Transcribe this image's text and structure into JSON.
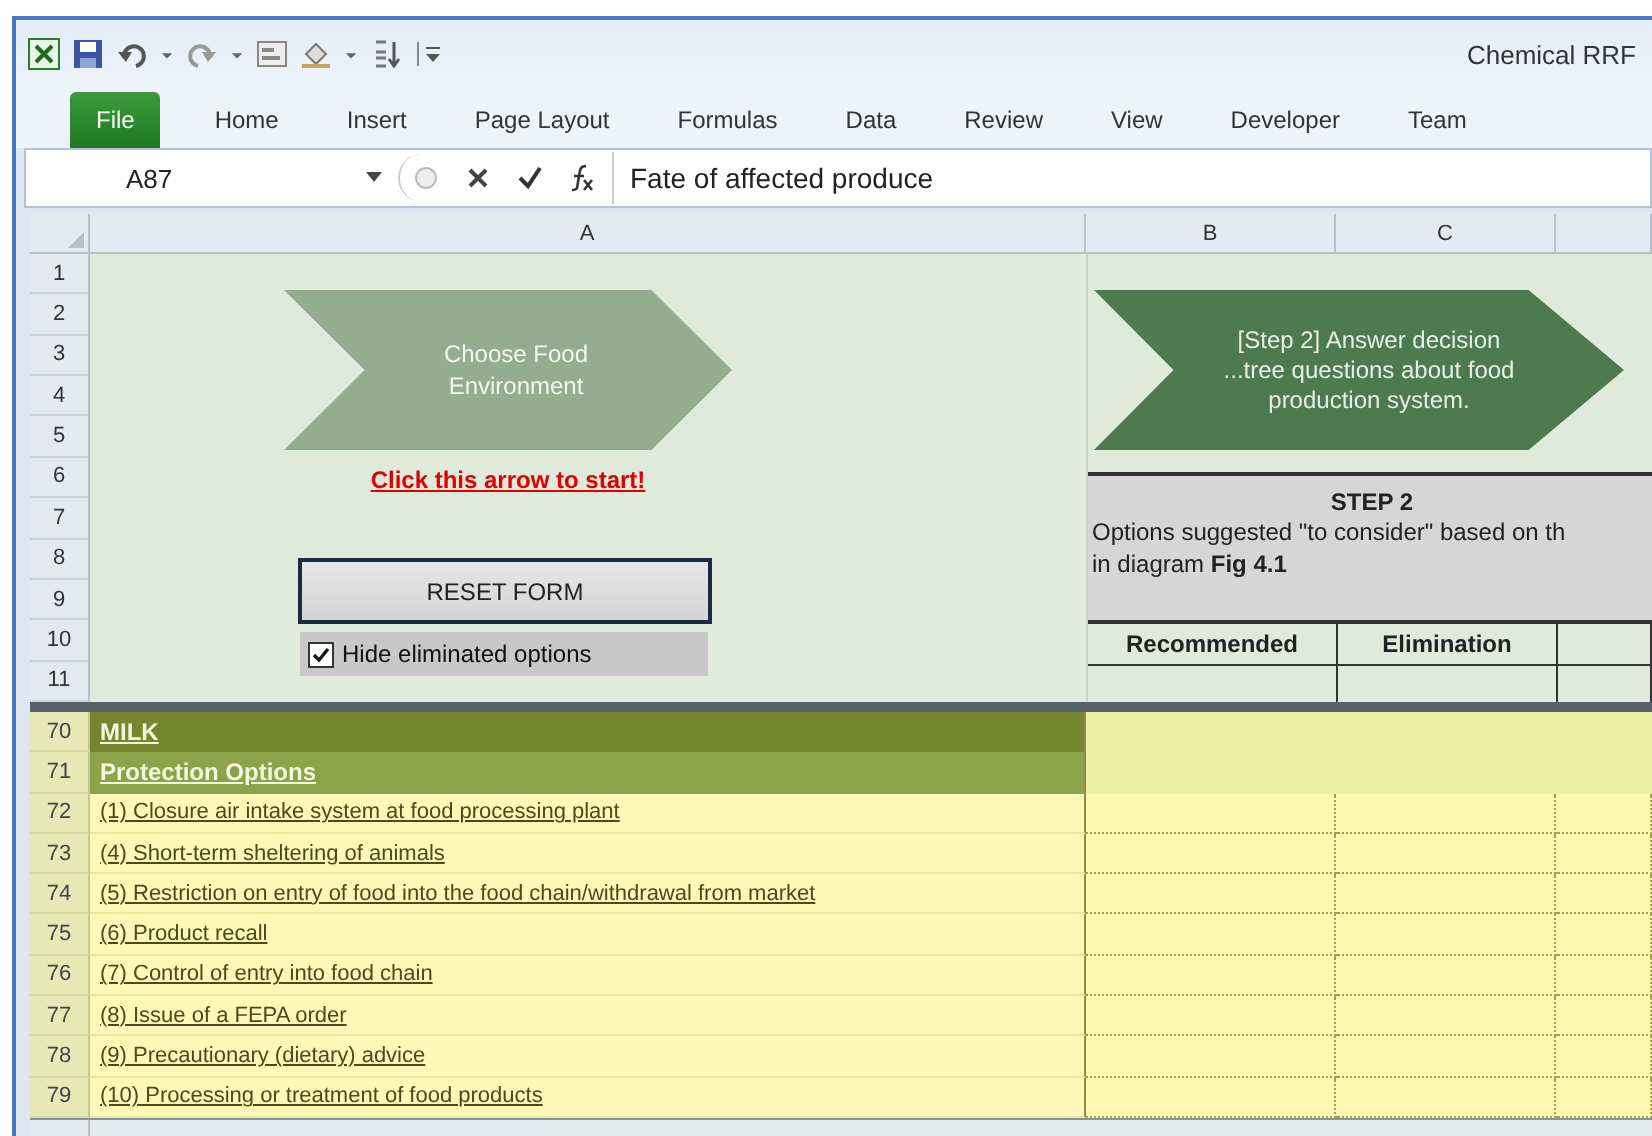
{
  "window": {
    "title": "Chemical RRF"
  },
  "ribbon_tabs": [
    {
      "label": "File",
      "kind": "file"
    },
    {
      "label": "Home",
      "kind": "tab"
    },
    {
      "label": "Insert",
      "kind": "tab"
    },
    {
      "label": "Page Layout",
      "kind": "tab"
    },
    {
      "label": "Formulas",
      "kind": "tab"
    },
    {
      "label": "Data",
      "kind": "tab"
    },
    {
      "label": "Review",
      "kind": "tab"
    },
    {
      "label": "View",
      "kind": "tab"
    },
    {
      "label": "Developer",
      "kind": "tab"
    },
    {
      "label": "Team",
      "kind": "tab"
    }
  ],
  "formula_bar": {
    "name_box": "A87",
    "formula": "Fate of affected produce"
  },
  "columns": [
    "A",
    "B",
    "C"
  ],
  "top_rows": [
    "1",
    "2",
    "3",
    "4",
    "5",
    "6",
    "7",
    "8",
    "9",
    "10",
    "11"
  ],
  "start_arrow": {
    "text": "Choose Food Environment"
  },
  "start_link": "Click this arrow to start!",
  "reset_button": "RESET FORM",
  "hide_option": {
    "label": "Hide eliminated options",
    "checked": true
  },
  "step_arrow": {
    "text": "[Step 2] Answer decision ...tree questions about food production system."
  },
  "step_box": {
    "title": "STEP 2",
    "lines": [
      "Options suggested \"to consider\" based on th",
      "in diagram **Fig 4.1**"
    ]
  },
  "table_headers": [
    "Recommended",
    "Elimination"
  ],
  "rows": [
    {
      "number": "70",
      "kind": "section",
      "text": "MILK"
    },
    {
      "number": "71",
      "kind": "subsection",
      "text": "Protection Options"
    },
    {
      "number": "72",
      "kind": "option",
      "text": "(1) Closure air intake system at food processing plant"
    },
    {
      "number": "73",
      "kind": "option",
      "text": "(4) Short-term sheltering of animals"
    },
    {
      "number": "74",
      "kind": "option",
      "text": "(5) Restriction on entry of food into the food chain/withdrawal from market"
    },
    {
      "number": "75",
      "kind": "option",
      "text": "(6) Product recall"
    },
    {
      "number": "76",
      "kind": "option",
      "text": "(7) Control of entry into food chain"
    },
    {
      "number": "77",
      "kind": "option",
      "text": "(8) Issue of a FEPA order"
    },
    {
      "number": "78",
      "kind": "option",
      "text": "(9) Precautionary (dietary) advice"
    },
    {
      "number": "79",
      "kind": "option",
      "text": "(10) Processing or treatment of food products"
    }
  ]
}
